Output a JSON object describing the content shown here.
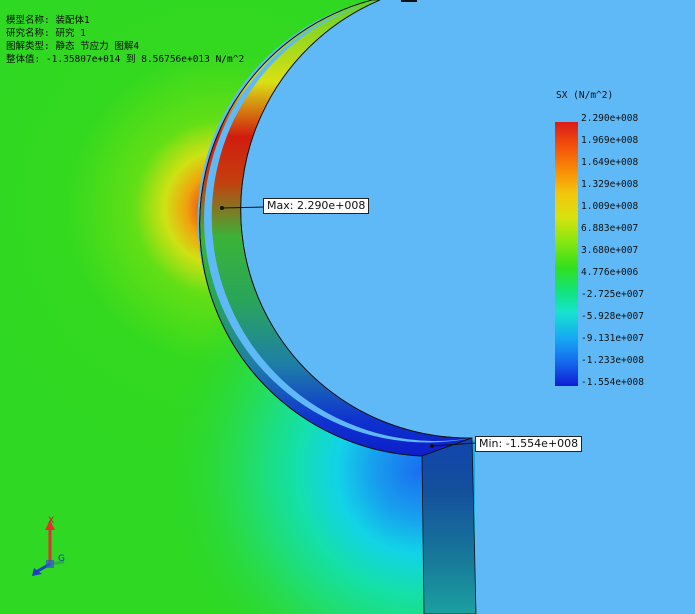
{
  "info": {
    "model_line": "模型名称: 装配体1",
    "study_line": "研究名称: 研究 1",
    "plot_type_line": "图解类型: 静态 节应力 图解4",
    "range_line": "整体值: -1.35807e+014 到 8.56756e+013 N/m^2"
  },
  "legend": {
    "title": "SX (N/m^2)",
    "labels": [
      "2.290e+008",
      "1.969e+008",
      "1.649e+008",
      "1.329e+008",
      "1.009e+008",
      "6.883e+007",
      "3.680e+007",
      "4.776e+006",
      "-2.725e+007",
      "-5.928e+007",
      "-9.131e+007",
      "-1.233e+008",
      "-1.554e+008"
    ]
  },
  "callouts": {
    "max": "Max: 2.290e+008",
    "min": "Min: -1.554e+008"
  },
  "triad": {
    "x_axis": "X",
    "y_axis": "G"
  },
  "colors": {
    "background": "#5fb9f7",
    "max_stress": "#d71c1c",
    "min_stress": "#0f1cd3"
  }
}
